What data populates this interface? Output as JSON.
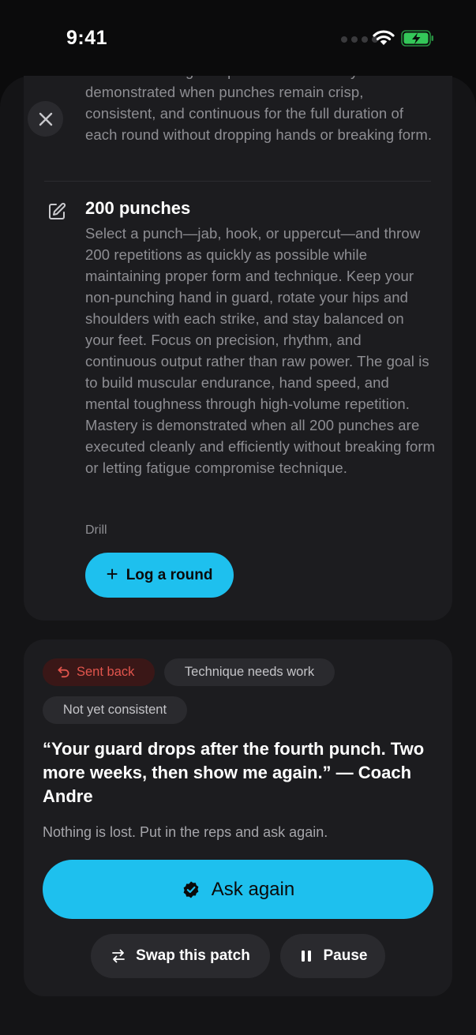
{
  "status_bar": {
    "time": "9:41"
  },
  "drill_card": {
    "previous_description": "for sustained high-output rounds. Mastery is demonstrated when punches remain crisp, consistent, and continuous for the full duration of each round without dropping hands or breaking form.",
    "title": "200 punches",
    "description": "Select a punch—jab, hook, or uppercut—and throw 200 repetitions as quickly as possible while maintaining proper form and technique. Keep your non-punching hand in guard, rotate your hips and shoulders with each strike, and stay balanced on your feet. Focus on precision, rhythm, and continuous output rather than raw power. The goal is to build muscular endurance, hand speed, and mental toughness through high-volume repetition. Mastery is demonstrated when all 200 punches are executed cleanly and efficiently without breaking form or letting fatigue compromise technique.",
    "tag": "Drill",
    "log_button": {
      "icon": "plus-icon",
      "label": "Log a round"
    }
  },
  "feedback_card": {
    "chips": {
      "sent_back": "Sent back",
      "technique": "Technique needs work",
      "consistency": "Not yet consistent"
    },
    "quote": "“Your guard drops after the fourth punch. Two more weeks, then show me again.” — Coach Andre",
    "note": "Nothing is lost. Put in the reps and ask again.",
    "ask_button": "Ask again",
    "swap_button": "Swap this patch",
    "pause_button": "Pause"
  },
  "colors": {
    "accent": "#1ec0ee",
    "danger": "#e2554d",
    "battery": "#34c759"
  }
}
